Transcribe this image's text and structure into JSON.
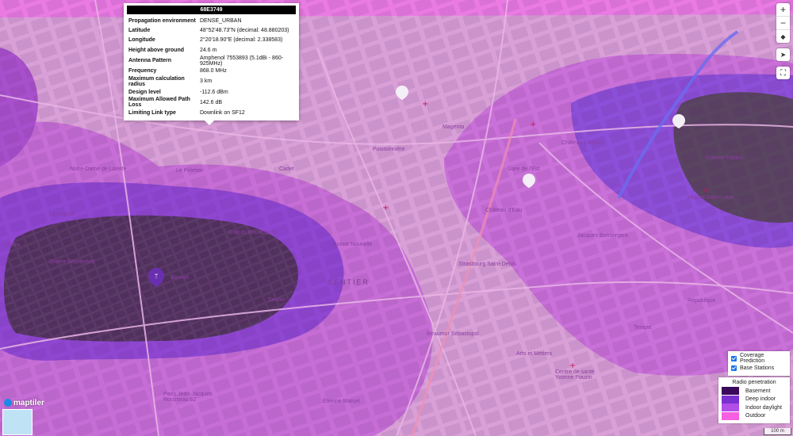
{
  "info_popup": {
    "title": "68E3749",
    "rows": [
      {
        "key": "Propagation environment",
        "value": "DENSE_URBAN"
      },
      {
        "key": "Latitude",
        "value": "48°52'48.73\"N    (decimal: 48.880203)"
      },
      {
        "key": "Longitude",
        "value": "2°20'18.90\"E    (decimal: 2.338583)"
      },
      {
        "key": "Height above ground",
        "value": "24.6 m"
      },
      {
        "key": "Antenna Pattern",
        "value": "Amphenol 7553893 (5.1dBi - 860-925MHz)"
      },
      {
        "key": "Frequency",
        "value": "868.0 MHz"
      },
      {
        "key": "Maximum calculation radius",
        "value": "3 km"
      },
      {
        "key": "Design level",
        "value": "-112.6 dBm"
      },
      {
        "key": "Maximum Allowed Path Loss",
        "value": "142.6 dB"
      },
      {
        "key": "Limiting Link type",
        "value": "Downlink on SF12"
      }
    ]
  },
  "controls": {
    "zoom_in": "+",
    "zoom_out": "−",
    "compass": "◆",
    "locate": "➤",
    "fullscreen": "⛶"
  },
  "layers": {
    "coverage_label": "Coverage Prediction",
    "stations_label": "Base Stations",
    "coverage_checked": true,
    "stations_checked": true
  },
  "legend": {
    "title": "Radio penetration",
    "items": [
      {
        "label": "Basement",
        "color": "#3a0a5a"
      },
      {
        "label": "Deep indoor",
        "color": "#7a2fd0"
      },
      {
        "label": "Indoor daylight",
        "color": "#b24de8"
      },
      {
        "label": "Outdoor",
        "color": "#f55fe0"
      }
    ]
  },
  "map_labels": {
    "district": "SENTIER",
    "streets": [
      "Quatre Septembre",
      "Bourse",
      "Grands Boulevards",
      "Bonne Nouvelle",
      "Strasbourg Saint-Denis",
      "Château d'Eau",
      "Jacques Bonsergent",
      "République",
      "Temple",
      "Arts et Métiers",
      "Sentier",
      "Réaumur Sébastopol",
      "Étienne Marcel",
      "Paris Jean-Jacques Rousseau 62",
      "Château Landon",
      "Gare de l'Est",
      "Hôpital Saint-Louis",
      "Centre de santé Yvonne Pouzin",
      "Opéra",
      "La Fayette",
      "Notre-Dame de Lorette",
      "Cadet",
      "Le Peletier",
      "Poissonnière",
      "Magenta",
      "Colonel Fabien"
    ]
  },
  "branding": {
    "logo_text": "maptiler",
    "scale_label": "100 m"
  }
}
